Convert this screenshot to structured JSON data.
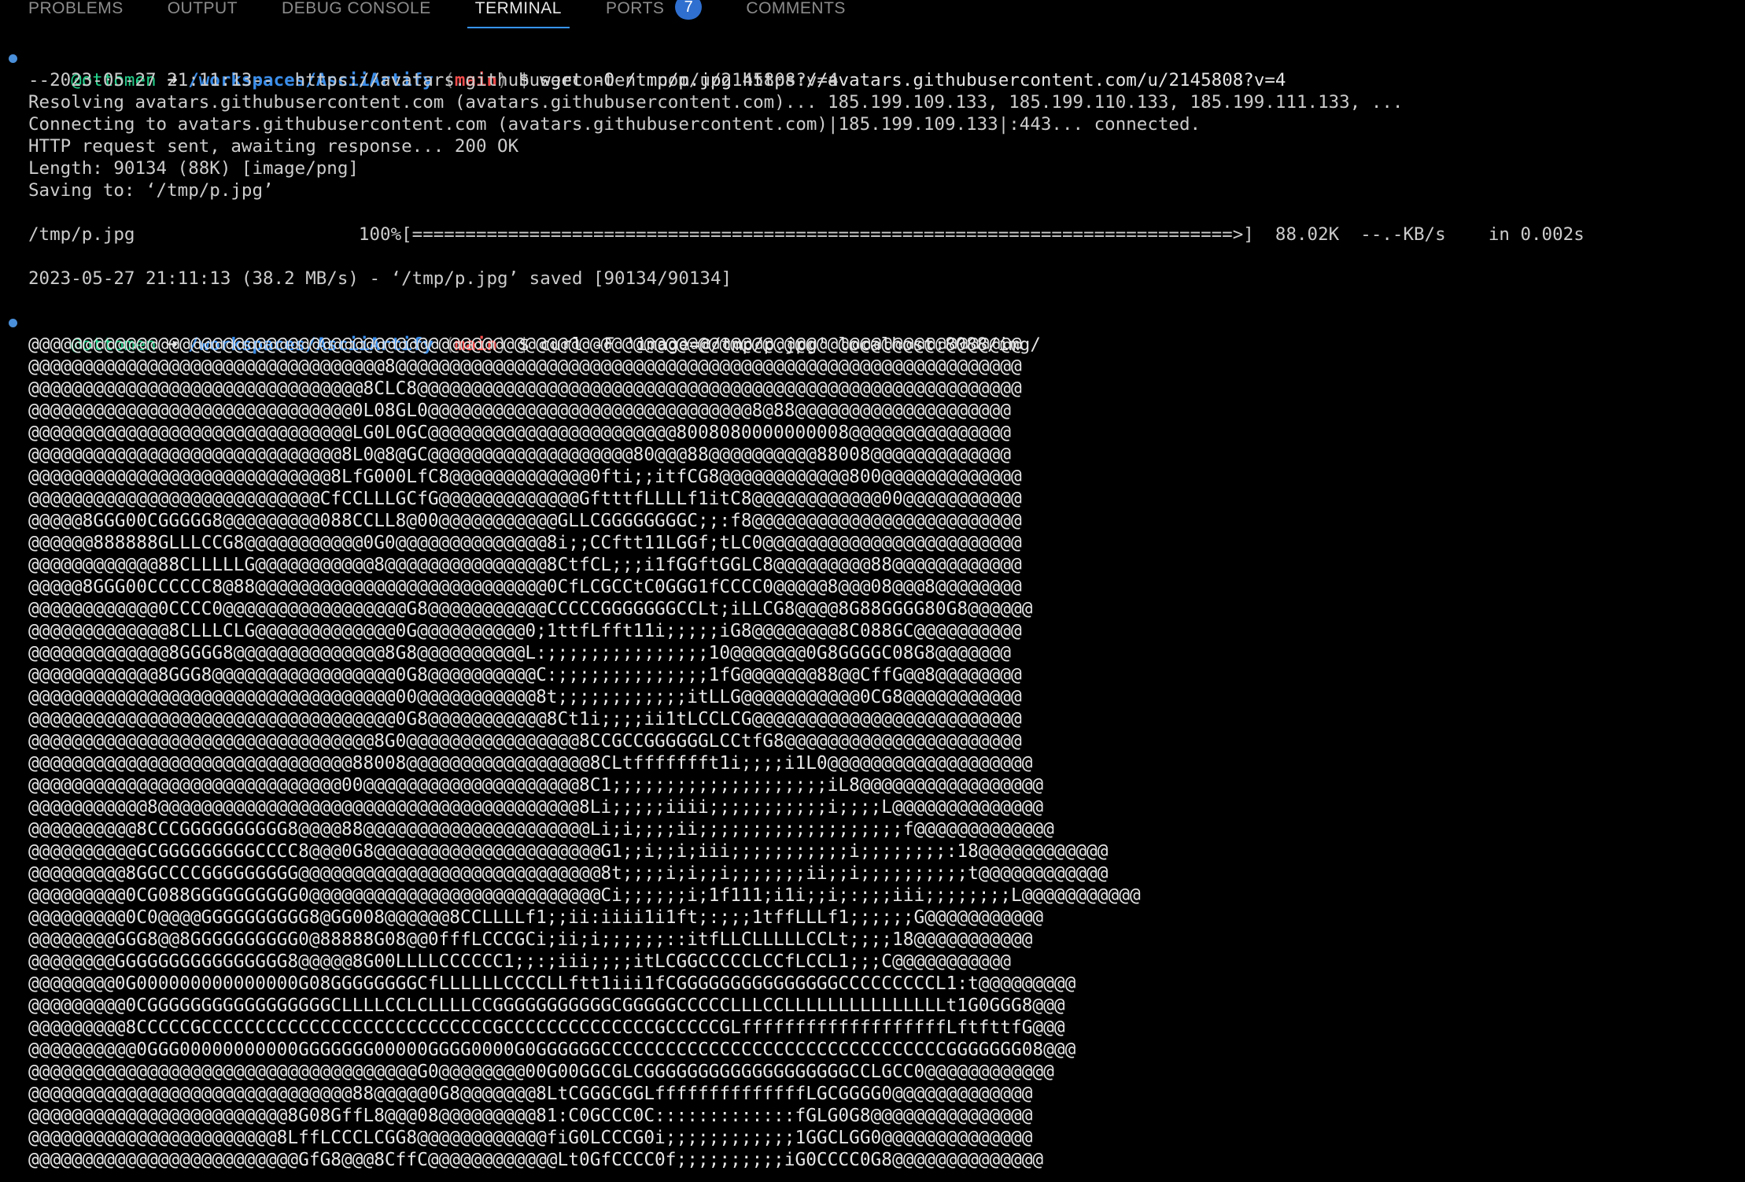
{
  "panel": {
    "tabs": [
      {
        "label": "PROBLEMS"
      },
      {
        "label": "OUTPUT"
      },
      {
        "label": "DEBUG CONSOLE"
      },
      {
        "label": "TERMINAL"
      },
      {
        "label": "PORTS"
      },
      {
        "label": "COMMENTS"
      }
    ],
    "ports_badge": "7",
    "active_tab": "TERMINAL"
  },
  "prompt1": {
    "user": "@ottomen",
    "arrow": "➜",
    "path": "/workspaces/AsciiArtify",
    "branch_open": "(",
    "branch": "main",
    "branch_close": ")",
    "symbol": "$",
    "command": "wget -O /tmp/p.jpg https://avatars.githubusercontent.com/u/2145808?v=4"
  },
  "wget_output": {
    "line1": "--2023-05-27 21:11:13--  https://avatars.githubusercontent.com/u/2145808?v=4",
    "line2": "Resolving avatars.githubusercontent.com (avatars.githubusercontent.com)... 185.199.109.133, 185.199.110.133, 185.199.111.133, ...",
    "line3": "Connecting to avatars.githubusercontent.com (avatars.githubusercontent.com)|185.199.109.133|:443... connected.",
    "line4": "HTTP request sent, awaiting response... 200 OK",
    "line5": "Length: 90134 (88K) [image/png]",
    "line6": "Saving to: ‘/tmp/p.jpg’",
    "progress": "/tmp/p.jpg                     100%[=============================================================================>]  88.02K  --.-KB/s    in 0.002s",
    "saved": "2023-05-27 21:11:13 (38.2 MB/s) - ‘/tmp/p.jpg’ saved [90134/90134]"
  },
  "prompt2": {
    "user": "@ottomen",
    "arrow": "➜",
    "path": "/workspaces/AsciiArtify",
    "branch_open": "(",
    "branch": "main",
    "branch_close": ")",
    "symbol": "$",
    "command": "curl -F 'image=@/tmp/p.jpg' localhost:8088/img/"
  },
  "ascii_art": [
    "@@@@@@@@@@@@@@@@@@@@@@@@@@@@@@@@@@@@@@@@@@@@@@@@@@@@@@@@@@@@@@@@@@@@@@@@@@@@@@@@@@@@@@@@@@@@",
    "@@@@@@@@@@@@@@@@@@@@@@@@@@@@@@@@@8@@@@@@@@@@@@@@@@@@@@@@@@@@@@@@@@@@@@@@@@@@@@@@@@@@@@@@@@@@",
    "@@@@@@@@@@@@@@@@@@@@@@@@@@@@@@@8CLC8@@@@@@@@@@@@@@@@@@@@@@@@@@@@@@@@@@@@@@@@@@@@@@@@@@@@@@@@",
    "@@@@@@@@@@@@@@@@@@@@@@@@@@@@@@0L08GL0@@@@@@@@@@@@@@@@@@@@@@@@@@@@@@8@88@@@@@@@@@@@@@@@@@@@@",
    "@@@@@@@@@@@@@@@@@@@@@@@@@@@@@@LG0L0GC@@@@@@@@@@@@@@@@@@@@@@@8008080000000008@@@@@@@@@@@@@@@",
    "@@@@@@@@@@@@@@@@@@@@@@@@@@@@@8L0@8@GC@@@@@@@@@@@@@@@@@@@80@@@88@@@@@@@@@@88008@@@@@@@@@@@@@",
    "@@@@@@@@@@@@@@@@@@@@@@@@@@@@8LfG000LfC8@@@@@@@@@@@@@0fti;;itfCG8@@@@@@@@@@@@800@@@@@@@@@@@@@",
    "@@@@@@@@@@@@@@@@@@@@@@@@@@@CfCCLLLGCfG@@@@@@@@@@@@@GftttfLLLLf1itC8@@@@@@@@@@@@00@@@@@@@@@@@",
    "@@@@@8GGG00CGGGGG8@@@@@@@@@088CCLL8@00@@@@@@@@@@@GLLCGGGGGGGGC;;:f8@@@@@@@@@@@@@@@@@@@@@@@@@",
    "@@@@@@888888GLLLCCG8@@@@@@@@@@@0G0@@@@@@@@@@@@@@8i;;CCftt11LGGf;tLC0@@@@@@@@@@@@@@@@@@@@@@@@",
    "@@@@@@@@@@@@88CLLLLLG@@@@@@@@@@@8@@@@@@@@@@@@@@@8CtfCL;;;i1fGGftGGLC8@@@@@@@@@88@@@@@@@@@@@@",
    "@@@@@8GGG00CCCCCC8@88@@@@@@@@@@@@@@@@@@@@@@@@@@@0CfLCGCCtC0GGG1fCCCC0@@@@@8@@@08@@@8@@@@@@@@",
    "@@@@@@@@@@@@0CCCC0@@@@@@@@@@@@@@@@@G8@@@@@@@@@@@CCCCCGGGGGGGCCLt;iLLCG8@@@@8G88GGGG80G8@@@@@@",
    "@@@@@@@@@@@@@8CLLLCLG@@@@@@@@@@@@@0G@@@@@@@@@@0;1ttfLfft11i;;;;;iG8@@@@@@@@8C088GC@@@@@@@@@@",
    "@@@@@@@@@@@@@8GGGG8@@@@@@@@@@@@@@8G8@@@@@@@@@@L:;;;;;;;;;;;;;;;10@@@@@@@0G8GGGGC08G8@@@@@@@",
    "@@@@@@@@@@@@8GGG8@@@@@@@@@@@@@@@@@0G8@@@@@@@@@@C:;;;;;;;;;;;;;;1fG@@@@@@@88@@CffG@@8@@@@@@@@",
    "@@@@@@@@@@@@@@@@@@@@@@@@@@@@@@@@@@00@@@@@@@@@@@8t;;;;;;;;;;;;itLLG@@@@@@@@@@@0CG8@@@@@@@@@@@",
    "@@@@@@@@@@@@@@@@@@@@@@@@@@@@@@@@@@0G8@@@@@@@@@@@8Ct1i;;;;ii1tLCCLCG@@@@@@@@@@@@@@@@@@@@@@@@@",
    "@@@@@@@@@@@@@@@@@@@@@@@@@@@@@@@@8G0@@@@@@@@@@@@@@@@8CCGCCGGGGGGLCCtfG8@@@@@@@@@@@@@@@@@@@@@@",
    "@@@@@@@@@@@@@@@@@@@@@@@@@@@@@@88008@@@@@@@@@@@@@@@@@8CLtffffffft1i;;;;i1L0@@@@@@@@@@@@@@@@@@@",
    "@@@@@@@@@@@@@@@@@@@@@@@@@@@@@00@@@@@@@@@@@@@@@@@@@@8C1;;;;;;;;;;;;;;;;;;;;iL8@@@@@@@@@@@@@@@@@",
    "@@@@@@@@@@@8@@@@@@@@@@@@@@@@@@@@@@@@@@@@@@@@@@@@@@@8Li;;;;;iiii;;;;;;;;;;;i;;;;L@@@@@@@@@@@@@@",
    "@@@@@@@@@@8CCCGGGGGGGGGG8@@@@88@@@@@@@@@@@@@@@@@@@@@Li;i;;;;ii;;;;;;;;;;;;;;;;;;;f@@@@@@@@@@@@@",
    "@@@@@@@@@@GCGGGGGGGGGCCCC8@@@0G8@@@@@@@@@@@@@@@@@@@@@G1;;i;;i;iii;;;;;;;;;;;i;;;;;;;;:18@@@@@@@@@@@@",
    "@@@@@@@@@8GGCCCCGGGGGGGGG@@@@@@@@@@@@@@@@@@@@@@@@@@@@8t;;;;i;i;;i;;;;;;;ii;;i;;;;;;;;;;t@@@@@@@@@@@@",
    "@@@@@@@@@0CG088GGGGGGGGGG0@@@@@@@@@@@@@@@@@@@@@@@@@@@Ci;;;;;;i;1f111;i1i;;i;:;;;iii;;;;;;;;L@@@@@@@@@@@",
    "@@@@@@@@@0C0@@@@GGGGGGGGGG8@GG008@@@@@@8CCLLLLf1;;ii:iiii1i1ft;:;;;1tffLLLf1;;;;;;G@@@@@@@@@@@",
    "@@@@@@@@GGG8@@8GGGGGGGGGG0@88888G08@@0fffLCCCGCi;ii;i;;;;;;::itfLLCLLLLLCCLt;;;;18@@@@@@@@@@@",
    "@@@@@@@@GGGGGGGGGGGGGGGG8@@@@@8G00LLLLCCCCCC1;;:;iii;;;;itLCGGCCCCCLCCfLCCL1;;;C@@@@@@@@@@@",
    "@@@@@@@@0G000000000000000G08GGGGGGGGCfLLLLLLCCCCLLftt1iii1fCGGGGGGGGGGGGGGGCCCCCCCCCL1:t@@@@@@@@@",
    "@@@@@@@@@0CGGGGGGGGGGGGGGGGGCLLLLCCLCLLLLCCGGGGGGGGGGGCGGGGGCCCCCLLLCCLLLLLLLLLLLLLLLt1G0GGG8@@@",
    "@@@@@@@@@8CCCCCGCCCCCCCCCCCCCCCCCCCCCCCCCCCGCCCCCCCCCCCCCCGCCCCCGLfffffffffffffffffffLftfttfG@@@",
    "@@@@@@@@@@0GGG00000000000GGGGGGG00000GGGG0000G0GGGGGGCCCCCCCCCCCCCCCCCCCCCCCCCCCCCCCCGGGGGGG08@@@",
    "@@@@@@@@@@@@@@@@@@@@@@@@@@@@@@@@@@@@G0@@@@@@@@00G00GGCGLCGGGGGGGGGGGGGGGGGGGCCLGCC0@@@@@@@@@@@@",
    "@@@@@@@@@@@@@@@@@@@@@@@@@@@@@@88@@@@@0G8@@@@@@@8LtCGGGCGGLffffffffffffffLGCGGGG0@@@@@@@@@@@@@",
    "@@@@@@@@@@@@@@@@@@@@@@@@8G08GffL8@@@08@@@@@@@@@81:C0GCCC0C:::::::::::::fGLG0G8@@@@@@@@@@@@@@@",
    "@@@@@@@@@@@@@@@@@@@@@@@8LffLCCCLCGG8@@@@@@@@@@@@fiG0LCCCG0i;;;;;;;;;;;;1GGCLGG0@@@@@@@@@@@@@@",
    "@@@@@@@@@@@@@@@@@@@@@@@@@GfG8@@@8CffC@@@@@@@@@@@@Lt0GfCCCC0f;;;;;;;;;;iG0CCCC0G8@@@@@@@@@@@@@@"
  ],
  "colors": {
    "background": "#000000",
    "text": "#cccccc",
    "user": "#23d18b",
    "path": "#3b8eea",
    "branch": "#f14c4c",
    "tab_active_underline": "#3794ff",
    "badge": "#2f6fcf"
  }
}
